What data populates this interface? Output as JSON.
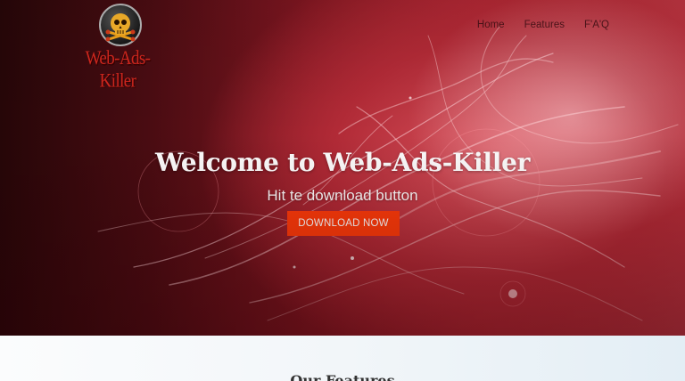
{
  "brand": {
    "name": "Web-Ads-Killer",
    "logo_icon": "skull-crossbones-icon"
  },
  "nav": {
    "items": [
      {
        "label": "Home"
      },
      {
        "label": "Features"
      },
      {
        "label": "F'A'Q"
      }
    ]
  },
  "hero": {
    "headline": "Welcome to Web-Ads-Killer",
    "subheadline": "Hit te download button",
    "cta_label": "DOWNLOAD NOW"
  },
  "features": {
    "title": "Our Features"
  },
  "colors": {
    "accent": "#ff3b0a",
    "logo_text": "#d1271e",
    "hero_dark": "#260608",
    "hero_light": "#d9545e"
  }
}
